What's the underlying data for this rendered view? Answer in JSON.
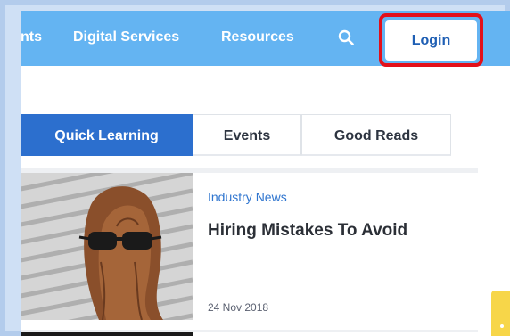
{
  "nav": {
    "items": [
      {
        "label": "nts"
      },
      {
        "label": "Digital Services"
      },
      {
        "label": "Resources"
      }
    ],
    "search_icon": "search-icon",
    "login_label": "Login",
    "highlight_color": "#e3101a",
    "bar_color": "#64b4f2"
  },
  "tabs": [
    {
      "label": "Quick Learning",
      "active": true
    },
    {
      "label": "Events",
      "active": false
    },
    {
      "label": "Good Reads",
      "active": false
    }
  ],
  "article": {
    "category": "Industry News",
    "title": "Hiring Mistakes To Avoid",
    "date": "24 Nov 2018"
  },
  "colors": {
    "accent": "#2c6fce",
    "widget": "#f7d649"
  }
}
